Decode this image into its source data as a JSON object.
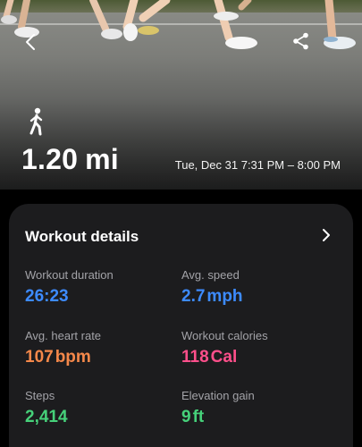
{
  "hero": {
    "distance_value": "1.20",
    "distance_unit": "mi",
    "datetime": "Tue, Dec 31 7:31 PM – 8:00 PM",
    "activity_icon": "walking-person-icon"
  },
  "nav": {
    "back_icon": "chevron-left-icon",
    "share_icon": "share-icon"
  },
  "workout_details": {
    "title": "Workout details",
    "stats": {
      "duration": {
        "label": "Workout duration",
        "value": "26:23",
        "unit": "",
        "color": "#3d8bff"
      },
      "speed": {
        "label": "Avg. speed",
        "value": "2.7",
        "unit": "mph",
        "color": "#3d8bff"
      },
      "heart_rate": {
        "label": "Avg. heart rate",
        "value": "107",
        "unit": "bpm",
        "color": "#f5884a"
      },
      "calories": {
        "label": "Workout calories",
        "value": "118",
        "unit": "Cal",
        "color": "#ff4f8b"
      },
      "steps": {
        "label": "Steps",
        "value": "2,414",
        "unit": "",
        "color": "#46d17a"
      },
      "elevation": {
        "label": "Elevation gain",
        "value": "9",
        "unit": "ft",
        "color": "#46d17a"
      }
    }
  }
}
